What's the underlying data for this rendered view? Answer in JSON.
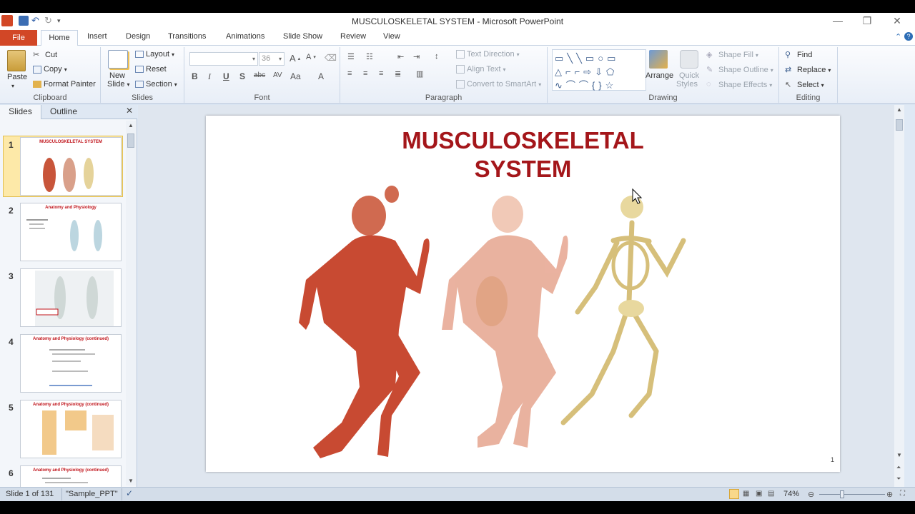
{
  "window": {
    "title": "MUSCULOSKELETAL  SYSTEM  -  Microsoft PowerPoint"
  },
  "tabs": {
    "file": "File",
    "items": [
      "Home",
      "Insert",
      "Design",
      "Transitions",
      "Animations",
      "Slide Show",
      "Review",
      "View"
    ]
  },
  "ribbon": {
    "clipboard": {
      "label": "Clipboard",
      "paste": "Paste",
      "cut": "Cut",
      "copy": "Copy",
      "format_painter": "Format Painter"
    },
    "slides": {
      "label": "Slides",
      "new_slide": "New",
      "new_slide2": "Slide",
      "layout": "Layout",
      "reset": "Reset",
      "section": "Section"
    },
    "font": {
      "label": "Font",
      "size": "36"
    },
    "paragraph": {
      "label": "Paragraph",
      "text_direction": "Text Direction",
      "align_text": "Align Text",
      "smartart": "Convert to SmartArt"
    },
    "drawing": {
      "label": "Drawing",
      "arrange": "Arrange",
      "quick_styles": "Quick",
      "quick_styles2": "Styles",
      "shape_fill": "Shape Fill",
      "shape_outline": "Shape Outline",
      "shape_effects": "Shape Effects"
    },
    "editing": {
      "label": "Editing",
      "find": "Find",
      "replace": "Replace",
      "select": "Select"
    }
  },
  "pane": {
    "tabs": [
      "Slides",
      "Outline"
    ],
    "thumbnails": [
      {
        "num": "1",
        "title": "MUSCULOSKELETAL SYSTEM"
      },
      {
        "num": "2",
        "title": "Anatomy and Physiology"
      },
      {
        "num": "3",
        "title": ""
      },
      {
        "num": "4",
        "title": "Anatomy and Physiology (continued)"
      },
      {
        "num": "5",
        "title": "Anatomy and Physiology (continued)"
      },
      {
        "num": "6",
        "title": "Anatomy and Physiology (continued)"
      }
    ]
  },
  "slide": {
    "title_line1": "MUSCULOSKELETAL",
    "title_line2": "SYSTEM",
    "number": "1"
  },
  "status": {
    "slide_info": "Slide 1 of 131",
    "theme": "\"Sample_PPT\"",
    "zoom": "74%"
  },
  "colors": {
    "file_tab": "#d24726",
    "title_red": "#a4161a"
  }
}
